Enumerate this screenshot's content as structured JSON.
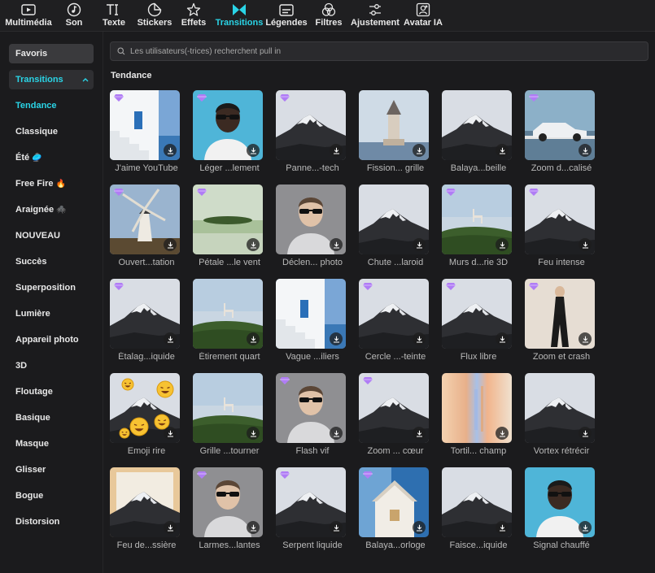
{
  "toolbar": {
    "items": [
      {
        "label": "Multimédia",
        "icon": "media-icon"
      },
      {
        "label": "Son",
        "icon": "music-note-icon"
      },
      {
        "label": "Texte",
        "icon": "text-icon"
      },
      {
        "label": "Stickers",
        "icon": "sticker-icon"
      },
      {
        "label": "Effets",
        "icon": "effects-star-icon"
      },
      {
        "label": "Transitions",
        "icon": "transitions-icon"
      },
      {
        "label": "Légendes",
        "icon": "captions-icon"
      },
      {
        "label": "Filtres",
        "icon": "filters-icon"
      },
      {
        "label": "Ajustement",
        "icon": "adjust-sliders-icon"
      },
      {
        "label": "Avatar IA",
        "icon": "ai-avatar-icon"
      }
    ],
    "active": "Transitions",
    "accent": "#2ad4e6"
  },
  "sidebar": {
    "items": [
      {
        "label": "Favoris"
      },
      {
        "label": "Transitions"
      },
      {
        "label": "Tendance"
      },
      {
        "label": "Classique"
      },
      {
        "label": "Été",
        "emoji": "🥏"
      },
      {
        "label": "Free Fire",
        "emoji": "🔥"
      },
      {
        "label": "Araignée",
        "emoji": "🕷️"
      },
      {
        "label": "NOUVEAU"
      },
      {
        "label": "Succès"
      },
      {
        "label": "Superposition"
      },
      {
        "label": "Lumière"
      },
      {
        "label": "Appareil photo"
      },
      {
        "label": "3D"
      },
      {
        "label": "Floutage"
      },
      {
        "label": "Basique"
      },
      {
        "label": "Masque"
      },
      {
        "label": "Glisser"
      },
      {
        "label": "Bogue"
      },
      {
        "label": "Distorsion"
      }
    ]
  },
  "search": {
    "placeholder": "Les utilisateurs(-trices) recherchent pull in"
  },
  "section": {
    "title": "Tendance"
  },
  "cards": [
    {
      "label": "J'aime YouTube",
      "thumb": "stairs",
      "premium": true
    },
    {
      "label": "Léger ...lement",
      "thumb": "man",
      "premium": true
    },
    {
      "label": "Panne...-tech",
      "thumb": "mountain",
      "premium": true
    },
    {
      "label": "Fission... grille",
      "thumb": "tower",
      "premium": false
    },
    {
      "label": "Balaya...beille",
      "thumb": "mountain",
      "premium": false
    },
    {
      "label": "Zoom d...calisé",
      "thumb": "car",
      "premium": true
    },
    {
      "label": "Ouvert...tation",
      "thumb": "windmill",
      "premium": true
    },
    {
      "label": "Pétale ...le vent",
      "thumb": "field",
      "premium": true
    },
    {
      "label": "Déclen... photo",
      "thumb": "woman",
      "premium": false
    },
    {
      "label": "Chute ...laroid",
      "thumb": "mountain",
      "premium": false
    },
    {
      "label": "Murs d...rie 3D",
      "thumb": "chair",
      "premium": true
    },
    {
      "label": "Feu intense",
      "thumb": "mountain",
      "premium": true
    },
    {
      "label": "Étalag...iquide",
      "thumb": "mountain",
      "premium": true
    },
    {
      "label": "Étirement quart",
      "thumb": "chair",
      "premium": false
    },
    {
      "label": "Vague ...iliers",
      "thumb": "stairs",
      "premium": false
    },
    {
      "label": "Cercle ...-teinte",
      "thumb": "mountain",
      "premium": true
    },
    {
      "label": "Flux libre",
      "thumb": "mountain",
      "premium": true
    },
    {
      "label": "Zoom et crash",
      "thumb": "model",
      "premium": true
    },
    {
      "label": "Emoji rire",
      "thumb": "emoji",
      "premium": false
    },
    {
      "label": "Grille ...tourner",
      "thumb": "chair",
      "premium": false
    },
    {
      "label": "Flash vif",
      "thumb": "woman",
      "premium": true
    },
    {
      "label": "Zoom ... cœur",
      "thumb": "mountain",
      "premium": true
    },
    {
      "label": "Tortil... champ",
      "thumb": "blur",
      "premium": false
    },
    {
      "label": "Vortex rétrécir",
      "thumb": "mountain",
      "premium": false
    },
    {
      "label": "Feu de...ssière",
      "thumb": "mountain-glow",
      "premium": false
    },
    {
      "label": "Larmes...lantes",
      "thumb": "woman",
      "premium": true
    },
    {
      "label": "Serpent liquide",
      "thumb": "mountain",
      "premium": true
    },
    {
      "label": "Balaya...orloge",
      "thumb": "house",
      "premium": true
    },
    {
      "label": "Faisce...iquide",
      "thumb": "mountain",
      "premium": false
    },
    {
      "label": "Signal chauffé",
      "thumb": "man",
      "premium": false
    }
  ]
}
